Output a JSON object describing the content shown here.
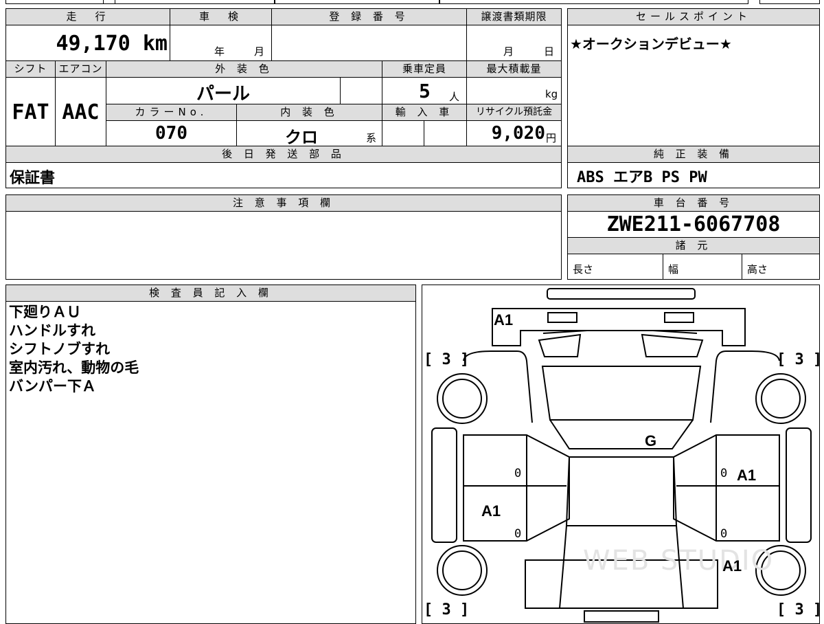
{
  "vehicle": {
    "mileage_label": "走　行",
    "mileage": "49,170 km",
    "inspection_label": "車　検",
    "inspection_year_unit": "年",
    "inspection_month_unit": "月",
    "registration_label": "登 録 番 号",
    "transfer_label": "譲渡書類期限",
    "transfer_month_unit": "月",
    "transfer_day_unit": "日",
    "shift_label": "シフト",
    "shift": "FAT",
    "aircon_label": "エアコン",
    "aircon": "AAC",
    "exterior_label": "外 装 色",
    "exterior_color": "パール",
    "capacity_label": "乗車定員",
    "capacity": "5",
    "capacity_unit": "人",
    "max_load_label": "最大積載量",
    "max_load_unit": "kg",
    "color_no_label": "カラーNo.",
    "color_no": "070",
    "interior_label": "内 装 色",
    "interior_color": "クロ",
    "interior_suffix": "系",
    "import_label": "輸 入 車",
    "recycle_label": "リサイクル預託金",
    "recycle_fee": "9,020",
    "recycle_unit": "円",
    "later_parts_label": "後 日 発 送 部 品",
    "later_parts": "保証書",
    "notes_label": "注 意 事 項 欄"
  },
  "sales": {
    "label": "セールスポイント",
    "text": "★オークションデビュー★"
  },
  "equipment": {
    "label": "純 正 装 備",
    "items": "ABS エアB PS PW"
  },
  "chassis": {
    "label": "車 台 番 号",
    "number": "ZWE211-6067708",
    "specs_label": "諸 元",
    "length_label": "長さ",
    "width_label": "幅",
    "height_label": "高さ"
  },
  "inspector": {
    "label": "検 査 員 記 入 欄",
    "notes": [
      "下廻りＡＵ",
      "ハンドルすれ",
      "シフトノブすれ",
      "室内汚れ、動物の毛",
      "バンパー下Ａ"
    ]
  },
  "diagram": {
    "marks": {
      "front_bumper": "A1",
      "windshield": "G",
      "left_front_door": "A1",
      "right_front_door": "A1",
      "right_rear_fender": "A1"
    },
    "tires": {
      "front_left": "[ 3 ]",
      "front_right": "[ 3 ]",
      "rear_left": "[ 3 ]",
      "rear_right": "[ 3 ]"
    },
    "zeros": [
      "0",
      "0",
      "0",
      "0"
    ],
    "watermark": "WEB STUDIO"
  }
}
